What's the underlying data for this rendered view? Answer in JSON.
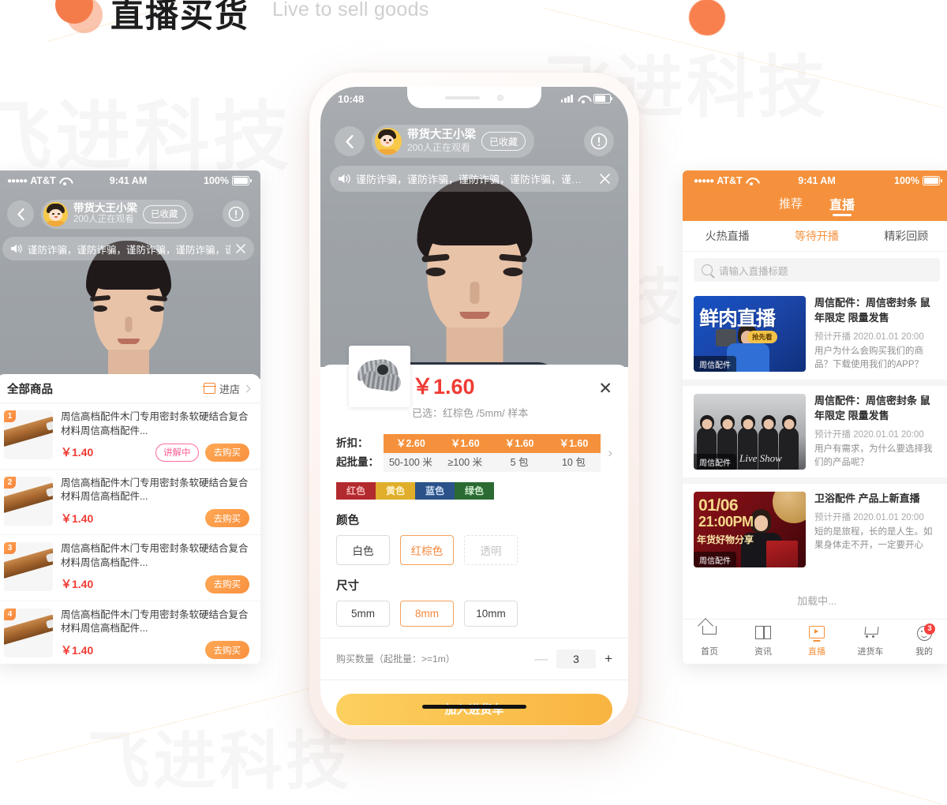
{
  "header": {
    "title": "直播买货",
    "subtitle": "Live to sell goods",
    "accent": "#f47c4a"
  },
  "watermarks": [
    "飞进科技",
    "飞进科技",
    "飞进科技",
    "飞进科技"
  ],
  "left_phone": {
    "status": {
      "carrier": "AT&T",
      "dots": "●●●●●",
      "time": "9:41 AM",
      "battery": "100%"
    },
    "host": {
      "name": "带货大王小梁",
      "viewers": "200人正在观看",
      "favorite_label": "已收藏",
      "back_icon": "chevron-left-icon",
      "report_icon": "exclamation-circle-icon"
    },
    "notice": {
      "icon": "speaker-icon",
      "text": "谨防诈骗，谨防诈骗，谨防诈骗，谨防诈骗，谨…",
      "close_icon": "close-icon"
    },
    "sheet": {
      "title": "全部商品",
      "shop_label": "进店",
      "shop_icon": "store-icon",
      "chevron_icon": "chevron-right-icon"
    },
    "products": [
      {
        "num": "1",
        "name": "周信高档配件木门专用密封条软硬结合复合材料周信高档配件...",
        "price": "￥1.40",
        "badge": "讲解中",
        "buy": "去购买"
      },
      {
        "num": "2",
        "name": "周信高档配件木门专用密封条软硬结合复合材料周信高档配件...",
        "price": "￥1.40",
        "badge": "",
        "buy": "去购买"
      },
      {
        "num": "3",
        "name": "周信高档配件木门专用密封条软硬结合复合材料周信高档配件...",
        "price": "￥1.40",
        "badge": "",
        "buy": "去购买"
      },
      {
        "num": "4",
        "name": "周信高档配件木门专用密封条软硬结合复合材料周信高档配件...",
        "price": "￥1.40",
        "badge": "",
        "buy": "去购买"
      }
    ]
  },
  "center_phone": {
    "status": {
      "time": "10:48"
    },
    "host": {
      "name": "带货大王小梁",
      "viewers": "200人正在观看",
      "favorite_label": "已收藏"
    },
    "notice": {
      "text": "谨防诈骗，谨防诈骗，谨防诈骗，谨防诈骗，谨…"
    },
    "detail": {
      "price": "￥1.60",
      "selected": "已选：红棕色 /5mm/ 样本",
      "close_icon": "close-icon",
      "tier_label_discount": "折扣：",
      "tier_label_moq": "起批量：",
      "tiers": [
        {
          "price": "￥2.60",
          "moq": "50-100 米"
        },
        {
          "price": "￥1.60",
          "moq": "≥100 米"
        },
        {
          "price": "￥1.60",
          "moq": "5 包"
        },
        {
          "price": "￥1.60",
          "moq": "10 包"
        }
      ],
      "tier_next_icon": "chevron-right-icon",
      "color_chips": [
        {
          "label": "红色",
          "bg": "#b32a2e",
          "fg": "#f4b6b6"
        },
        {
          "label": "黄色",
          "bg": "#e0ae2a",
          "fg": "#fff4cf"
        },
        {
          "label": "蓝色",
          "bg": "#2b5289",
          "fg": "#cfe0f5"
        },
        {
          "label": "绿色",
          "bg": "#2b6b33",
          "fg": "#cfeccf"
        }
      ],
      "color_section": {
        "title": "颜色",
        "options": [
          {
            "label": "白色",
            "state": "normal"
          },
          {
            "label": "红棕色",
            "state": "selected"
          },
          {
            "label": "透明",
            "state": "disabled"
          }
        ]
      },
      "size_section": {
        "title": "尺寸",
        "options": [
          {
            "label": "5mm",
            "state": "normal"
          },
          {
            "label": "8mm",
            "state": "selected"
          },
          {
            "label": "10mm",
            "state": "normal"
          }
        ]
      },
      "quantity": {
        "label": "购买数量",
        "hint": "（起批量：>=1m）",
        "minus": "—",
        "value": "3",
        "plus": "+"
      },
      "cart_button": "加入进货车"
    }
  },
  "right_phone": {
    "status": {
      "carrier": "AT&T",
      "dots": "●●●●●",
      "time": "9:41 AM",
      "battery": "100%"
    },
    "top_tabs": [
      {
        "label": "推荐",
        "active": false
      },
      {
        "label": "直播",
        "active": true
      }
    ],
    "sub_tabs": [
      {
        "label": "火热直播",
        "active": false
      },
      {
        "label": "等待开播",
        "active": true
      },
      {
        "label": "精彩回顾",
        "active": false
      }
    ],
    "search": {
      "placeholder": "请输入直播标题",
      "icon": "search-icon"
    },
    "cards": [
      {
        "cover_title": "鲜肉直播",
        "cover_pill": "抢先看",
        "cover_tag": "周信配件",
        "title": "周信配件：周信密封条 鼠年限定 限量发售",
        "time": "预计开播 2020.01.01 20:00",
        "desc": "用户为什么会购买我们的商品？下载使用我们的APP？"
      },
      {
        "cover_sig": "Live Show",
        "cover_tag": "周信配件",
        "title": "周信配件：周信密封条 鼠年限定 限量发售",
        "time": "预计开播 2020.01.01 20:00",
        "desc": "用户有需求，为什么要选择我们的产品呢？"
      },
      {
        "cover_date": "01/06",
        "cover_hour": "21:00PM",
        "cover_sub": "年货好物分享",
        "cover_tag": "周信配件",
        "title": "卫浴配件 产品上新直播",
        "time": "预计开播 2020.01.01 20:00",
        "desc": "短的是旅程，长的是人生。如果身体走不开，一定要开心"
      }
    ],
    "loading": "加载中...",
    "tabbar": [
      {
        "label": "首页",
        "icon": "home-icon",
        "active": false,
        "badge": ""
      },
      {
        "label": "资讯",
        "icon": "news-icon",
        "active": false,
        "badge": ""
      },
      {
        "label": "直播",
        "icon": "live-icon",
        "active": true,
        "badge": ""
      },
      {
        "label": "进货车",
        "icon": "cart-icon",
        "active": false,
        "badge": ""
      },
      {
        "label": "我的",
        "icon": "profile-icon",
        "active": false,
        "badge": "3"
      }
    ]
  }
}
